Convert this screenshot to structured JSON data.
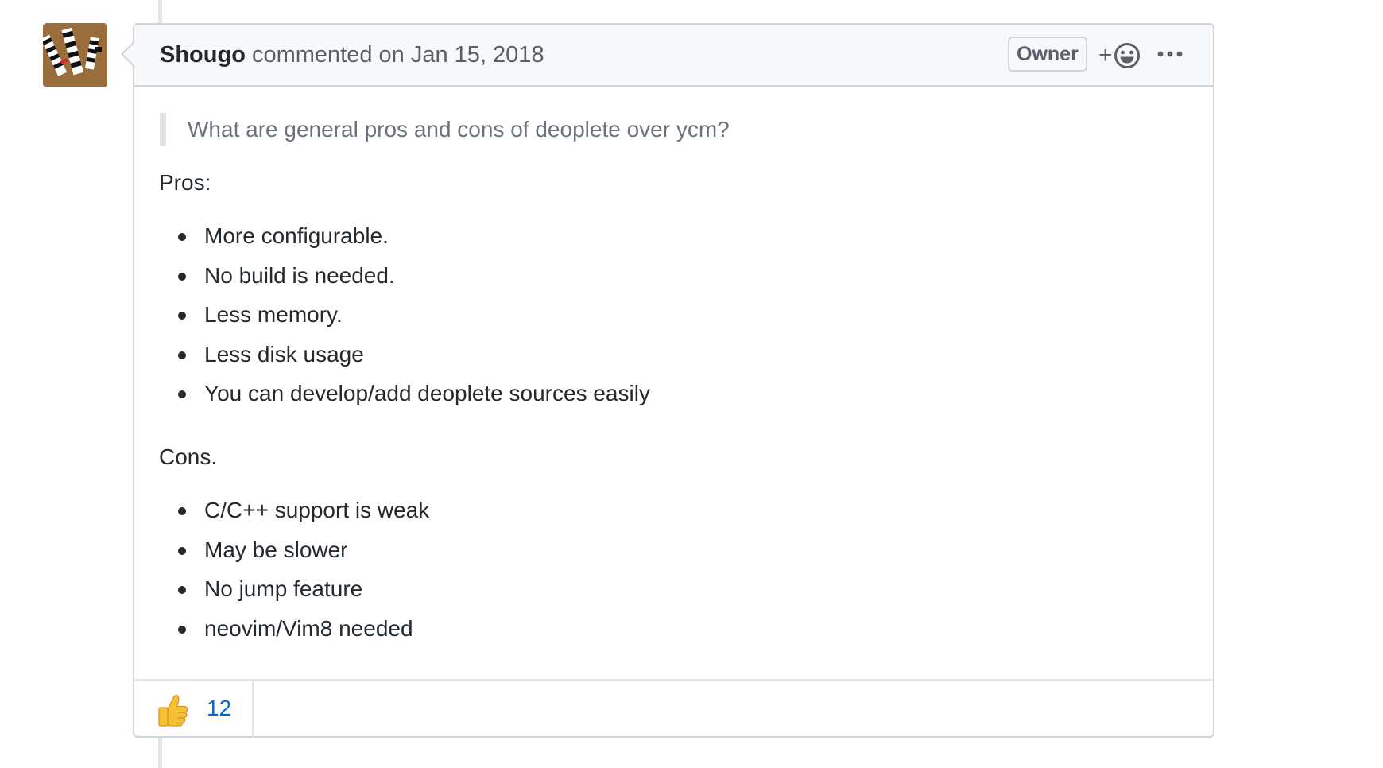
{
  "comment": {
    "author": "Shougo",
    "action_text": "commented on Jan 15, 2018",
    "badge": "Owner",
    "add_reaction_plus": "+",
    "quote": "What are general pros and cons of deoplete over ycm?",
    "pros_heading": "Pros:",
    "pros": [
      "More configurable.",
      "No build is needed.",
      "Less memory.",
      "Less disk usage",
      "You can develop/add deoplete sources easily"
    ],
    "cons_heading": "Cons.",
    "cons": [
      "C/C++ support is weak",
      "May be slower",
      "No jump feature",
      "neovim/Vim8 needed"
    ],
    "reactions": [
      {
        "emoji": "thumbs-up-icon",
        "count": "12"
      }
    ]
  },
  "colors": {
    "link_blue": "#0366d6",
    "muted_text": "#586069",
    "border": "#d1d5da",
    "header_bg": "#f6f8fa",
    "avatar_bg": "#9a6e3c"
  }
}
